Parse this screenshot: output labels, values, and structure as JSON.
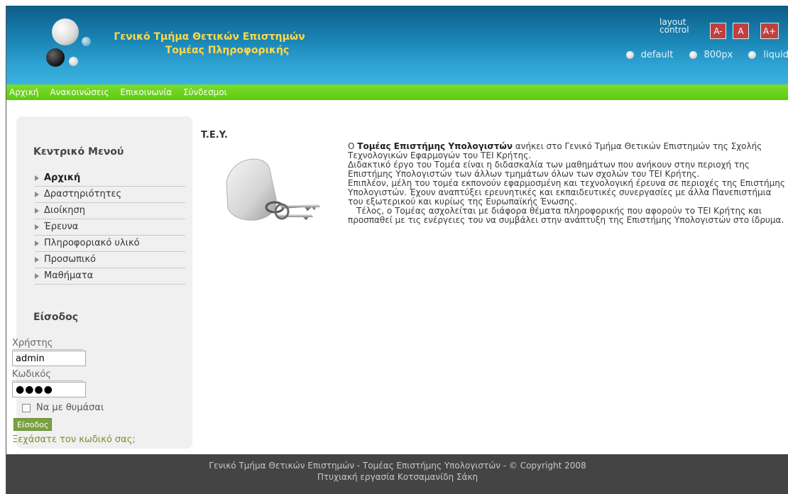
{
  "header": {
    "title_line1": "Γενικό Τμήμα Θετικών Επιστημών",
    "title_line2": "Τομέας Πληροφορικής",
    "layout_control": {
      "label": "layout control",
      "buttons": [
        "A-",
        "A",
        "A+"
      ],
      "options": [
        "default",
        "800px",
        "liquid"
      ]
    }
  },
  "nav": {
    "items": [
      "Αρχική",
      "Ανακοινώσεις",
      "Επικοινωνία",
      "Σύνδεσμοι"
    ]
  },
  "sidebar": {
    "menu_heading": "Κεντρικό Μενού",
    "menu_items": [
      "Αρχική",
      "Δραστηριότητες",
      "Διοίκηση",
      "Έρευνα",
      "Πληροφοριακό υλικό",
      "Προσωπικό",
      "Μαθήματα"
    ],
    "login_heading": "Είσοδος",
    "user_label": "Χρήστης",
    "user_value": "admin",
    "pass_label": "Κωδικός",
    "pass_value": "●●●●",
    "remember_label": "Να με θυμάσαι",
    "submit_label": "Είσοδος",
    "forgot_label": "Ξεχάσατε τον κωδικό σας;"
  },
  "main": {
    "title": "T.E.Y.",
    "intro_bold": "Τομέας Επιστήμης Υπολογιστών",
    "intro_prefix": "Ο ",
    "intro_rest": " ανήκει στο Γενικό Τμήμα Θετικών Επιστημών της Σχολής Τεχνολογικών Εφαρμογών του ΤΕΙ Κρήτης.",
    "para2": "Διδακτικό έργο του Τομέα είναι η διδασκαλία των μαθημάτων που ανήκουν στην περιοχή της Επιστήμης Υπολογιστών των άλλων τμημάτων όλων των σχολών του ΤΕΙ Κρήτης.",
    "para3": "Επιπλέον, μέλη του τομέα εκπονούν εφαρμοσμένη και τεχνολογική έρευνα σε περιοχές της Επιστήμης Υπολογιστών. Έχουν αναπτύξει ερευνητικές και εκπαιδευτικές συνεργασίες με άλλα Πανεπιστήμια του εξωτερικού και κυρίως της Ευρωπαϊκής Ένωσης.",
    "para4": "Τέλος, ο Τομέας ασχολείται με διάφορα θέματα πληροφορικής που αφορούν το ΤΕΙ Κρήτης και προσπαθεί με τις ενέργειες του να συμβάλει στην ανάπτυξη της Επιστήμης Υπολογιστών στο ίδρυμα."
  },
  "footer": {
    "line1": "Γενικό Τμήμα Θετικών Επιστημών - Τομέας Επιστήμης Υπολογιστών - © Copyright 2008",
    "line2": "Πτυχιακή εργασία Κοτσαμανίδη Σάκη"
  },
  "colors": {
    "header_blue": "#1a86b6",
    "nav_green": "#5fcc12",
    "title_yellow": "#ffd84a",
    "font_btn_red": "#bf4040",
    "footer_gray": "#444444"
  }
}
